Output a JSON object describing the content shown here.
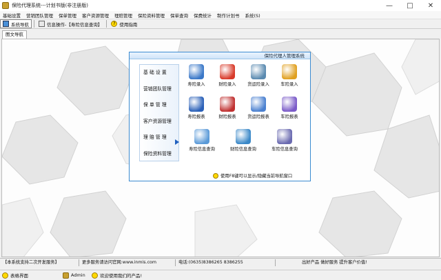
{
  "window": {
    "title": "保险代理系统---计划书版(非注册版)"
  },
  "menu": [
    "基础设置",
    "营销团队管理",
    "保单管理",
    "客户资源管理",
    "理赔管理",
    "保险资料管理",
    "保单查询",
    "保费统计",
    "制作计划书",
    "系统(S)"
  ],
  "toolbar": {
    "nav": "系统导航",
    "info": "信息操作-【寿险信息查询】",
    "help": "使用指南"
  },
  "subtab": "图文导航",
  "panel": {
    "title": "保险代理人管理系统",
    "nav": [
      "基 础 设 置",
      "营销团队管理",
      "保 单 管 理",
      "客户资源管理",
      "理 赔 管 理",
      "保险资料管理"
    ],
    "cells": [
      {
        "label": "寿险录入",
        "color": "#3a78c8"
      },
      {
        "label": "财险录入",
        "color": "#d83a2a"
      },
      {
        "label": "货运险录入",
        "color": "#5a8ab0"
      },
      {
        "label": "车险录入",
        "color": "#e0a020"
      },
      {
        "label": "寿险报表",
        "color": "#2a60b8"
      },
      {
        "label": "财险报表",
        "color": "#c03030"
      },
      {
        "label": "货运险报表",
        "color": "#4a80d0"
      },
      {
        "label": "车险报表",
        "color": "#7a5ac8"
      },
      {
        "label": "寿险信息查询",
        "color": "#5a9ad8"
      },
      {
        "label": "财险信息查询",
        "color": "#3a88c8"
      },
      {
        "label": "车险信息查询",
        "color": "#6a6ab0"
      }
    ],
    "footer": "使用F8键可以显示/隐藏当前导航窗口"
  },
  "status1": [
    "【本系统支持二次开发服务】",
    "更多服务请访问官网:www.inmis.com",
    "电话:(0635)8386265 8386255",
    "出好产品 做好服务 提升客户价值!"
  ],
  "status2": {
    "interface": "表格界面",
    "user": "Admin",
    "welcome": "欢迎使用我们的产品!"
  }
}
